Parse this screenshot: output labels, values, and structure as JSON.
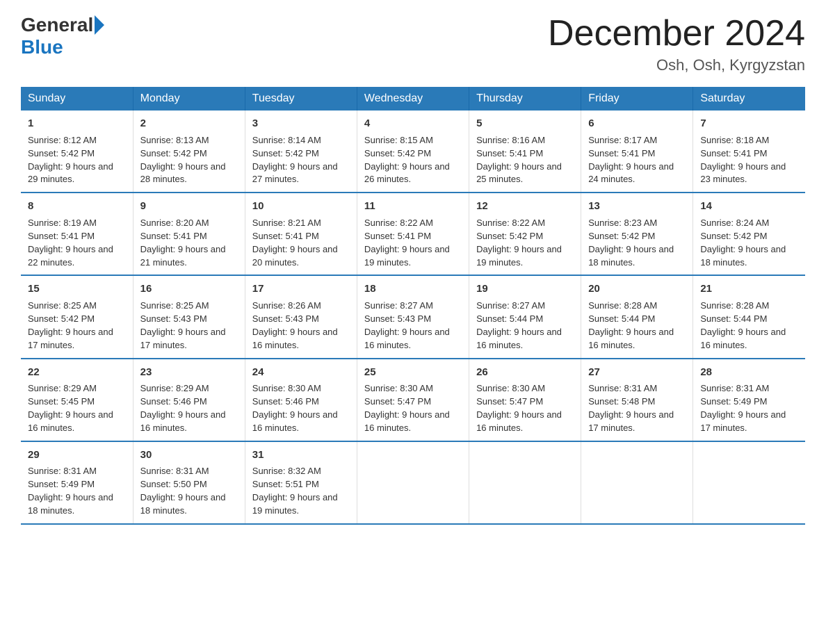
{
  "header": {
    "logo_general": "General",
    "logo_blue": "Blue",
    "title": "December 2024",
    "location": "Osh, Osh, Kyrgyzstan"
  },
  "weekdays": [
    "Sunday",
    "Monday",
    "Tuesday",
    "Wednesday",
    "Thursday",
    "Friday",
    "Saturday"
  ],
  "weeks": [
    [
      {
        "day": "1",
        "sunrise": "Sunrise: 8:12 AM",
        "sunset": "Sunset: 5:42 PM",
        "daylight": "Daylight: 9 hours and 29 minutes."
      },
      {
        "day": "2",
        "sunrise": "Sunrise: 8:13 AM",
        "sunset": "Sunset: 5:42 PM",
        "daylight": "Daylight: 9 hours and 28 minutes."
      },
      {
        "day": "3",
        "sunrise": "Sunrise: 8:14 AM",
        "sunset": "Sunset: 5:42 PM",
        "daylight": "Daylight: 9 hours and 27 minutes."
      },
      {
        "day": "4",
        "sunrise": "Sunrise: 8:15 AM",
        "sunset": "Sunset: 5:42 PM",
        "daylight": "Daylight: 9 hours and 26 minutes."
      },
      {
        "day": "5",
        "sunrise": "Sunrise: 8:16 AM",
        "sunset": "Sunset: 5:41 PM",
        "daylight": "Daylight: 9 hours and 25 minutes."
      },
      {
        "day": "6",
        "sunrise": "Sunrise: 8:17 AM",
        "sunset": "Sunset: 5:41 PM",
        "daylight": "Daylight: 9 hours and 24 minutes."
      },
      {
        "day": "7",
        "sunrise": "Sunrise: 8:18 AM",
        "sunset": "Sunset: 5:41 PM",
        "daylight": "Daylight: 9 hours and 23 minutes."
      }
    ],
    [
      {
        "day": "8",
        "sunrise": "Sunrise: 8:19 AM",
        "sunset": "Sunset: 5:41 PM",
        "daylight": "Daylight: 9 hours and 22 minutes."
      },
      {
        "day": "9",
        "sunrise": "Sunrise: 8:20 AM",
        "sunset": "Sunset: 5:41 PM",
        "daylight": "Daylight: 9 hours and 21 minutes."
      },
      {
        "day": "10",
        "sunrise": "Sunrise: 8:21 AM",
        "sunset": "Sunset: 5:41 PM",
        "daylight": "Daylight: 9 hours and 20 minutes."
      },
      {
        "day": "11",
        "sunrise": "Sunrise: 8:22 AM",
        "sunset": "Sunset: 5:41 PM",
        "daylight": "Daylight: 9 hours and 19 minutes."
      },
      {
        "day": "12",
        "sunrise": "Sunrise: 8:22 AM",
        "sunset": "Sunset: 5:42 PM",
        "daylight": "Daylight: 9 hours and 19 minutes."
      },
      {
        "day": "13",
        "sunrise": "Sunrise: 8:23 AM",
        "sunset": "Sunset: 5:42 PM",
        "daylight": "Daylight: 9 hours and 18 minutes."
      },
      {
        "day": "14",
        "sunrise": "Sunrise: 8:24 AM",
        "sunset": "Sunset: 5:42 PM",
        "daylight": "Daylight: 9 hours and 18 minutes."
      }
    ],
    [
      {
        "day": "15",
        "sunrise": "Sunrise: 8:25 AM",
        "sunset": "Sunset: 5:42 PM",
        "daylight": "Daylight: 9 hours and 17 minutes."
      },
      {
        "day": "16",
        "sunrise": "Sunrise: 8:25 AM",
        "sunset": "Sunset: 5:43 PM",
        "daylight": "Daylight: 9 hours and 17 minutes."
      },
      {
        "day": "17",
        "sunrise": "Sunrise: 8:26 AM",
        "sunset": "Sunset: 5:43 PM",
        "daylight": "Daylight: 9 hours and 16 minutes."
      },
      {
        "day": "18",
        "sunrise": "Sunrise: 8:27 AM",
        "sunset": "Sunset: 5:43 PM",
        "daylight": "Daylight: 9 hours and 16 minutes."
      },
      {
        "day": "19",
        "sunrise": "Sunrise: 8:27 AM",
        "sunset": "Sunset: 5:44 PM",
        "daylight": "Daylight: 9 hours and 16 minutes."
      },
      {
        "day": "20",
        "sunrise": "Sunrise: 8:28 AM",
        "sunset": "Sunset: 5:44 PM",
        "daylight": "Daylight: 9 hours and 16 minutes."
      },
      {
        "day": "21",
        "sunrise": "Sunrise: 8:28 AM",
        "sunset": "Sunset: 5:44 PM",
        "daylight": "Daylight: 9 hours and 16 minutes."
      }
    ],
    [
      {
        "day": "22",
        "sunrise": "Sunrise: 8:29 AM",
        "sunset": "Sunset: 5:45 PM",
        "daylight": "Daylight: 9 hours and 16 minutes."
      },
      {
        "day": "23",
        "sunrise": "Sunrise: 8:29 AM",
        "sunset": "Sunset: 5:46 PM",
        "daylight": "Daylight: 9 hours and 16 minutes."
      },
      {
        "day": "24",
        "sunrise": "Sunrise: 8:30 AM",
        "sunset": "Sunset: 5:46 PM",
        "daylight": "Daylight: 9 hours and 16 minutes."
      },
      {
        "day": "25",
        "sunrise": "Sunrise: 8:30 AM",
        "sunset": "Sunset: 5:47 PM",
        "daylight": "Daylight: 9 hours and 16 minutes."
      },
      {
        "day": "26",
        "sunrise": "Sunrise: 8:30 AM",
        "sunset": "Sunset: 5:47 PM",
        "daylight": "Daylight: 9 hours and 16 minutes."
      },
      {
        "day": "27",
        "sunrise": "Sunrise: 8:31 AM",
        "sunset": "Sunset: 5:48 PM",
        "daylight": "Daylight: 9 hours and 17 minutes."
      },
      {
        "day": "28",
        "sunrise": "Sunrise: 8:31 AM",
        "sunset": "Sunset: 5:49 PM",
        "daylight": "Daylight: 9 hours and 17 minutes."
      }
    ],
    [
      {
        "day": "29",
        "sunrise": "Sunrise: 8:31 AM",
        "sunset": "Sunset: 5:49 PM",
        "daylight": "Daylight: 9 hours and 18 minutes."
      },
      {
        "day": "30",
        "sunrise": "Sunrise: 8:31 AM",
        "sunset": "Sunset: 5:50 PM",
        "daylight": "Daylight: 9 hours and 18 minutes."
      },
      {
        "day": "31",
        "sunrise": "Sunrise: 8:32 AM",
        "sunset": "Sunset: 5:51 PM",
        "daylight": "Daylight: 9 hours and 19 minutes."
      },
      null,
      null,
      null,
      null
    ]
  ]
}
